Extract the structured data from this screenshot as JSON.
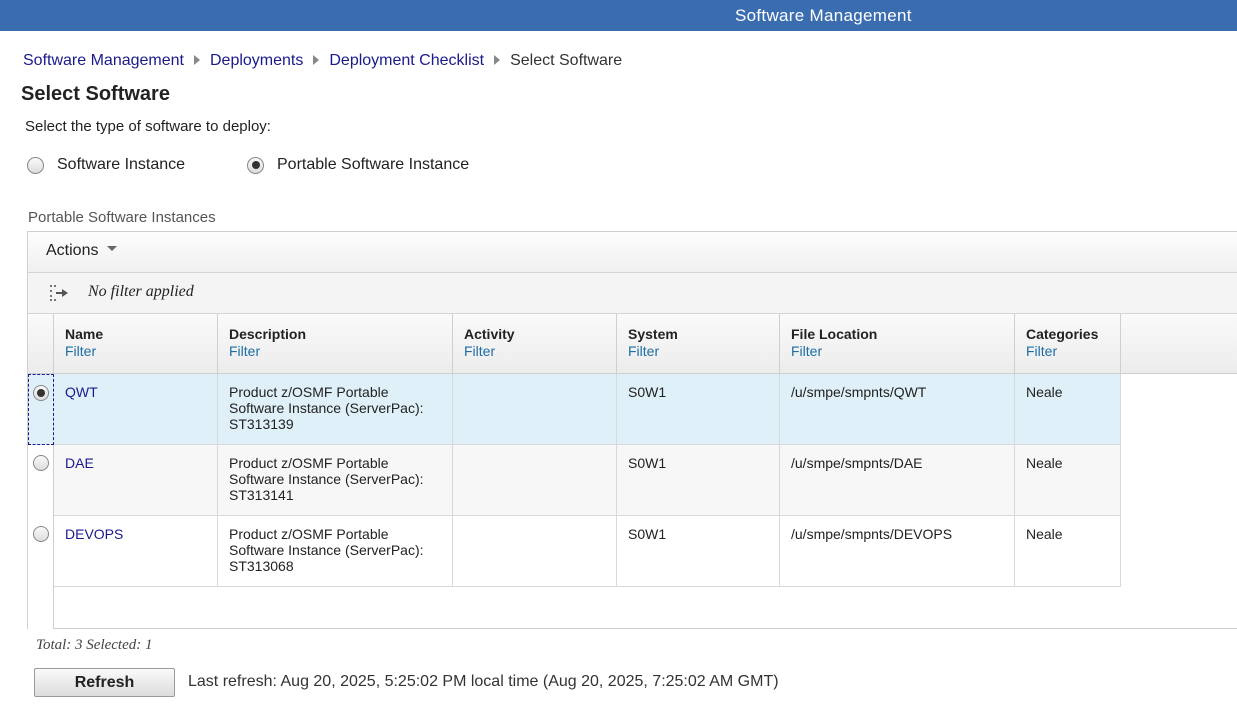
{
  "app": {
    "title": "Software Management"
  },
  "breadcrumb": [
    "Software Management",
    "Deployments",
    "Deployment Checklist"
  ],
  "breadcrumb_current": "Select Software",
  "page_title": "Select Software",
  "instruction": "Select the type of software to deploy:",
  "software_type": {
    "options": [
      "Software Instance",
      "Portable Software Instance"
    ],
    "selected": "Portable Software Instance"
  },
  "section_label": "Portable Software Instances",
  "toolbar": {
    "actions_label": "Actions",
    "filter_status": "No filter applied"
  },
  "columns": [
    {
      "name": "Name",
      "filter": "Filter"
    },
    {
      "name": "Description",
      "filter": "Filter"
    },
    {
      "name": "Activity",
      "filter": "Filter"
    },
    {
      "name": "System",
      "filter": "Filter"
    },
    {
      "name": "File Location",
      "filter": "Filter"
    },
    {
      "name": "Categories",
      "filter": "Filter"
    }
  ],
  "rows": [
    {
      "name": "QWT",
      "description": "Product z/OSMF Portable Software Instance (ServerPac): ST313139",
      "activity": "",
      "system": "S0W1",
      "file_location": "/u/smpe/smpnts/QWT",
      "categories": "Neale",
      "selected": true
    },
    {
      "name": "DAE",
      "description": "Product z/OSMF Portable Software Instance (ServerPac): ST313141",
      "activity": "",
      "system": "S0W1",
      "file_location": "/u/smpe/smpnts/DAE",
      "categories": "Neale",
      "selected": false
    },
    {
      "name": "DEVOPS",
      "description": "Product z/OSMF Portable Software Instance (ServerPac): ST313068",
      "activity": "",
      "system": "S0W1",
      "file_location": "/u/smpe/smpnts/DEVOPS",
      "categories": "Neale",
      "selected": false
    }
  ],
  "footer": {
    "total": "Total: 3 Selected: 1",
    "refresh_label": "Refresh",
    "last_refresh": "Last refresh: Aug 20, 2025, 5:25:02 PM local time (Aug 20, 2025, 7:25:02 AM GMT)"
  },
  "colors": {
    "header_bar": "#3a6db0",
    "link": "#1a1a8c",
    "selected_row": "#dff0f8",
    "filter_link": "#1c6ea4"
  }
}
